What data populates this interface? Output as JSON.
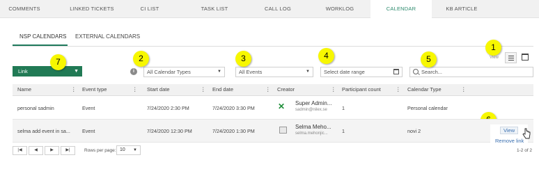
{
  "top_tabs": [
    "COMMENTS",
    "LINKED TICKETS",
    "CI LIST",
    "TASK LIST",
    "CALL LOG",
    "WORKLOG",
    "CALENDAR",
    "KB ARTICLE"
  ],
  "active_tab": "CALENDAR",
  "sub_tabs": [
    "NSP CALENDARS",
    "EXTERNAL CALENDARS"
  ],
  "toolbar": {
    "link_button": "Link",
    "calendar_types": "All Calendar Types",
    "events": "All Events",
    "date_range_placeholder": "Select date range",
    "search_placeholder": "Search..."
  },
  "badges": [
    "1",
    "2",
    "3",
    "4",
    "5",
    "6",
    "7"
  ],
  "view_label": "View",
  "table": {
    "columns": [
      "Name",
      "Event type",
      "Start date",
      "End date",
      "Creator",
      "Participant count",
      "Calendar Type"
    ],
    "rows": [
      {
        "name": "personal sadmin",
        "event_type": "Event",
        "start": "7/24/2020 2:30 PM",
        "end": "7/24/2020 3:30 PM",
        "creator_name": "Super Admin...",
        "creator_email": "sadmin@nilex.se",
        "participants": "1",
        "calendar_type": "Personal calendar"
      },
      {
        "name": "selma add event in sa...",
        "event_type": "Event",
        "start": "7/24/2020 12:30 PM",
        "end": "7/24/2020 1:30 PM",
        "creator_name": "Selma Meho...",
        "creator_email": "selma.mehonjic...",
        "participants": "1",
        "calendar_type": "novi 2"
      }
    ]
  },
  "row_menu": {
    "view": "View",
    "remove": "Remove link"
  },
  "pagination": {
    "rows_per_page_label": "Rows per page:",
    "rows_per_page": "10",
    "count": "1-2 of 2"
  },
  "colors": {
    "accent": "#217a55",
    "active_tab_text": "#2e8b6e",
    "badge": "#f7f700",
    "link": "#3a6fb0"
  }
}
